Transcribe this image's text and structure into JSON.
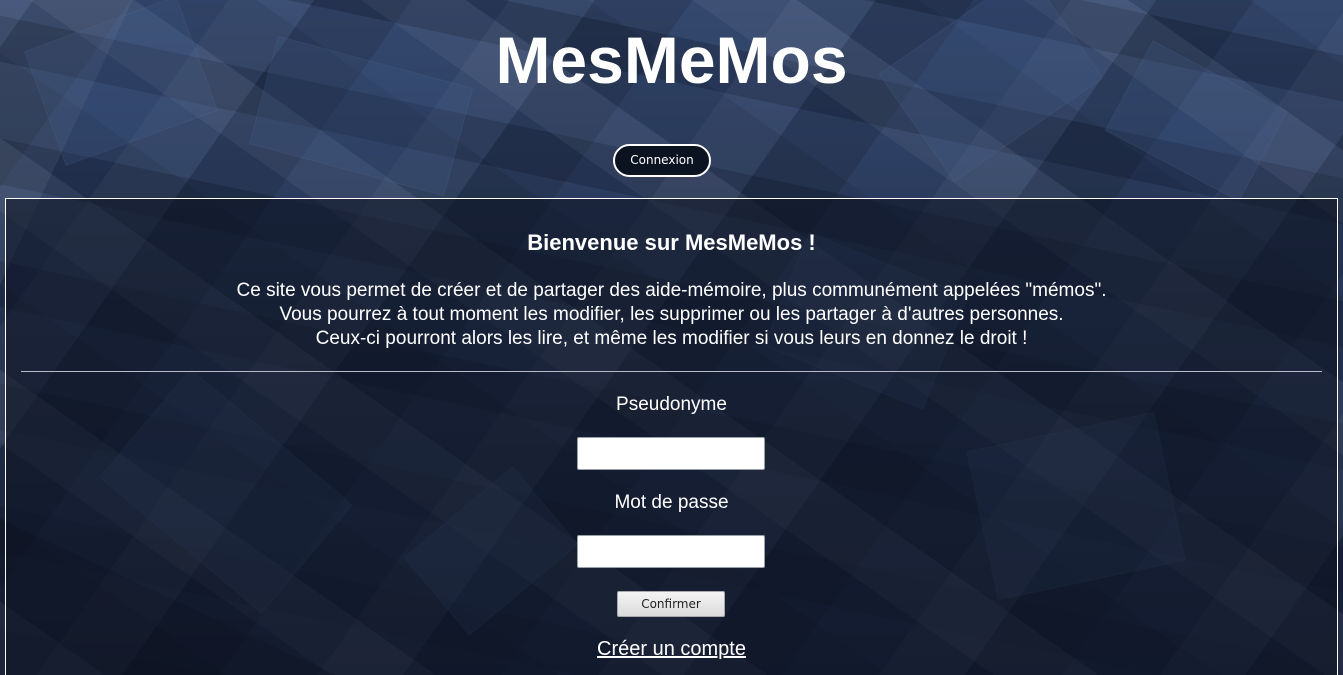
{
  "header": {
    "title": "MesMeMos",
    "login_button": "Connexion"
  },
  "welcome": {
    "heading": "Bienvenue sur MesMeMos !",
    "lines": [
      "Ce site vous permet de créer et de partager des aide-mémoire, plus communément appelées \"mémos\".",
      "Vous pourrez à tout moment les modifier, les supprimer ou les partager à d'autres personnes.",
      "Ceux-ci pourront alors les lire, et même les modifier si vous leurs en donnez le droit !"
    ]
  },
  "form": {
    "username_label": "Pseudonyme",
    "username_value": "",
    "password_label": "Mot de passe",
    "password_value": "",
    "confirm_button": "Confirmer",
    "create_account_link": "Créer un compte"
  },
  "colors": {
    "background": "#2a3a5a",
    "text": "#ffffff",
    "panel_border": "#ffffff"
  }
}
